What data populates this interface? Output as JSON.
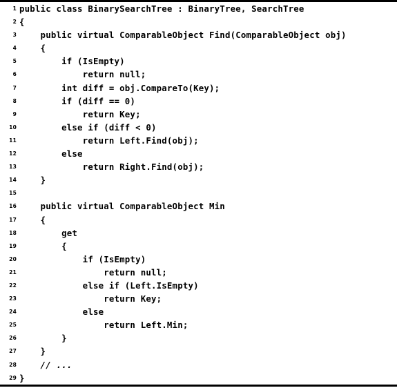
{
  "listing": {
    "language": "C#",
    "colors": {
      "text": "#000000",
      "background": "#ffffff",
      "rule": "#000000"
    },
    "rules": {
      "top_label": "top-rule",
      "bottom_label": "bottom-rule"
    },
    "lines": [
      {
        "number": "1",
        "code": "public class BinarySearchTree : BinaryTree, SearchTree",
        "style": "code"
      },
      {
        "number": "2",
        "code": "{",
        "style": "code"
      },
      {
        "number": "3",
        "code": "    public virtual ComparableObject Find(ComparableObject obj)",
        "style": "code"
      },
      {
        "number": "4",
        "code": "    {",
        "style": "code"
      },
      {
        "number": "5",
        "code": "        if (IsEmpty)",
        "style": "code"
      },
      {
        "number": "6",
        "code": "            return null;",
        "style": "code"
      },
      {
        "number": "7",
        "code": "        int diff = obj.CompareTo(Key);",
        "style": "code"
      },
      {
        "number": "8",
        "code": "        if (diff == 0)",
        "style": "code"
      },
      {
        "number": "9",
        "code": "            return Key;",
        "style": "code"
      },
      {
        "number": "10",
        "code": "        else if (diff < 0)",
        "style": "code"
      },
      {
        "number": "11",
        "code": "            return Left.Find(obj);",
        "style": "code"
      },
      {
        "number": "12",
        "code": "        else",
        "style": "code"
      },
      {
        "number": "13",
        "code": "            return Right.Find(obj);",
        "style": "code"
      },
      {
        "number": "14",
        "code": "    }",
        "style": "code"
      },
      {
        "number": "15",
        "code": "",
        "style": "code"
      },
      {
        "number": "16",
        "code": "    public virtual ComparableObject Min",
        "style": "code"
      },
      {
        "number": "17",
        "code": "    {",
        "style": "code"
      },
      {
        "number": "18",
        "code": "        get",
        "style": "code"
      },
      {
        "number": "19",
        "code": "        {",
        "style": "code"
      },
      {
        "number": "20",
        "code": "            if (IsEmpty)",
        "style": "code"
      },
      {
        "number": "21",
        "code": "                return null;",
        "style": "code"
      },
      {
        "number": "22",
        "code": "            else if (Left.IsEmpty)",
        "style": "code"
      },
      {
        "number": "23",
        "code": "                return Key;",
        "style": "code"
      },
      {
        "number": "24",
        "code": "            else",
        "style": "code"
      },
      {
        "number": "25",
        "code": "                return Left.Min;",
        "style": "code"
      },
      {
        "number": "26",
        "code": "        }",
        "style": "code"
      },
      {
        "number": "27",
        "code": "    }",
        "style": "code"
      },
      {
        "number": "28",
        "code": "    // ...",
        "style": "comment"
      },
      {
        "number": "29",
        "code": "}",
        "style": "code"
      }
    ]
  }
}
